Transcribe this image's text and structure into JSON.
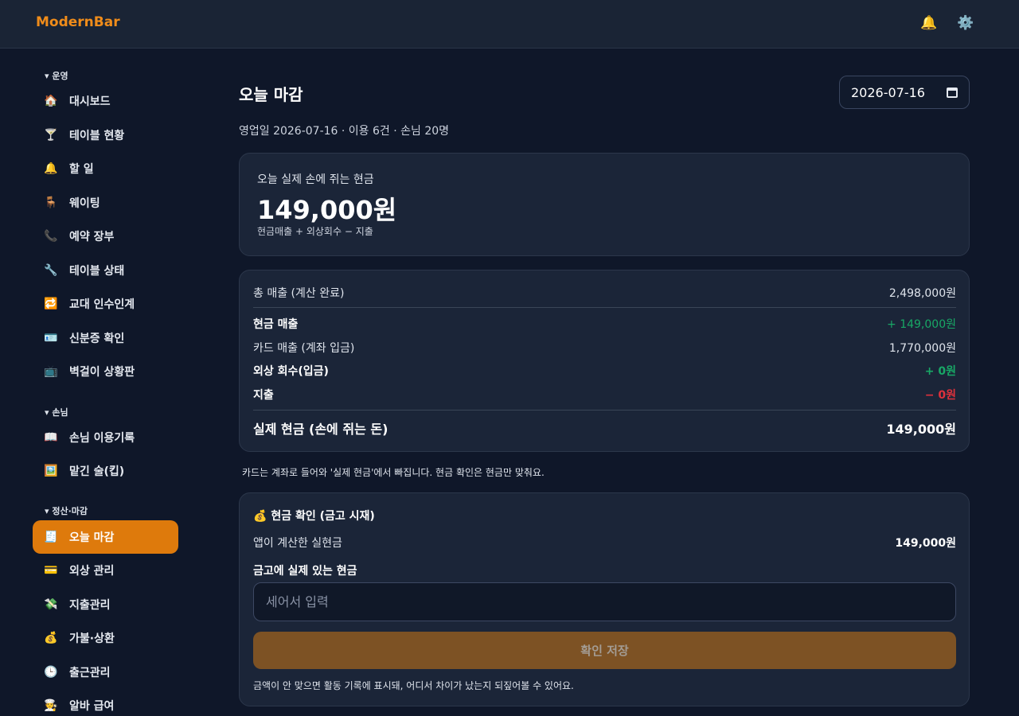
{
  "app": {
    "brand": "ModernBar"
  },
  "header": {
    "icons": [
      "bell-icon",
      "gear-icon"
    ]
  },
  "sidebar": {
    "sections": [
      {
        "title": "운영",
        "items": [
          {
            "label": "대시보드",
            "icon": "house-icon"
          },
          {
            "label": "테이블 현황",
            "icon": "cocktail-icon"
          },
          {
            "label": "할 일",
            "icon": "bell-icon"
          },
          {
            "label": "웨이팅",
            "icon": "chair-icon"
          },
          {
            "label": "예약 장부",
            "icon": "phone-icon"
          },
          {
            "label": "테이블 상태",
            "icon": "wrench-icon"
          },
          {
            "label": "교대 인수인계",
            "icon": "repeat-icon"
          },
          {
            "label": "신분증 확인",
            "icon": "id-card-icon"
          },
          {
            "label": "벽걸이 상황판",
            "icon": "tv-icon"
          }
        ]
      },
      {
        "title": "손님",
        "items": [
          {
            "label": "손님 이용기록",
            "icon": "book-icon"
          },
          {
            "label": "맡긴 술(킵)",
            "icon": "picture-icon"
          }
        ]
      },
      {
        "title": "정산·마감",
        "items": [
          {
            "label": "오늘 마감",
            "icon": "receipt-icon",
            "active": true
          },
          {
            "label": "외상 관리",
            "icon": "credit-card-icon"
          },
          {
            "label": "지출관리",
            "icon": "money-wings-icon"
          },
          {
            "label": "가불·상환",
            "icon": "money-bag-icon"
          },
          {
            "label": "출근관리",
            "icon": "clock-icon"
          },
          {
            "label": "알바 급여",
            "icon": "cook-icon"
          }
        ]
      }
    ]
  },
  "main": {
    "title": "오늘 마감",
    "date": "2026-07-16",
    "subtitle": "영업일 2026-07-16 · 이용 6건 · 손님 20명",
    "hero": {
      "label": "오늘 실제 손에 쥐는 현금",
      "amount": "149,000원",
      "note": "현금매출 + 외상회수 − 지출"
    },
    "summary": {
      "gross_label": "총 매출 (계산 완료)",
      "gross_value": "2,498,000원",
      "rows": [
        {
          "label": "현금 매출",
          "value": "+ 149,000원"
        },
        {
          "label": "카드 매출 (계좌 입금)",
          "value": "1,770,000원"
        },
        {
          "label": "외상 회수(입금)",
          "value": "+ 0원"
        },
        {
          "label": "지출",
          "value": "− 0원"
        }
      ],
      "total_label": "실제 현금 (손에 쥐는 돈)",
      "total_value": "149,000원"
    },
    "hint": "카드는 계좌로 들어와 '실제 현금'에서 빠집니다. 현금 확인은 현금만 맞춰요.",
    "cash_check": {
      "title": "현금 확인 (금고 시재)",
      "icon": "money-bag-icon",
      "app_label": "앱이 계산한 실현금",
      "app_value": "149,000원",
      "input_label": "금고에 실제 있는 현금",
      "input_placeholder": "세어서 입력",
      "button_label": "확인 저장",
      "footnote": "금액이 안 맞으면 활동 기록에 표시돼, 어디서 차이가 났는지 되짚어볼 수 있어요."
    }
  },
  "colors": {
    "accent": "#de7a0c",
    "positive": "#18a866",
    "negative": "#e0313c",
    "background": "#0f1729",
    "card": "#1b2538"
  }
}
